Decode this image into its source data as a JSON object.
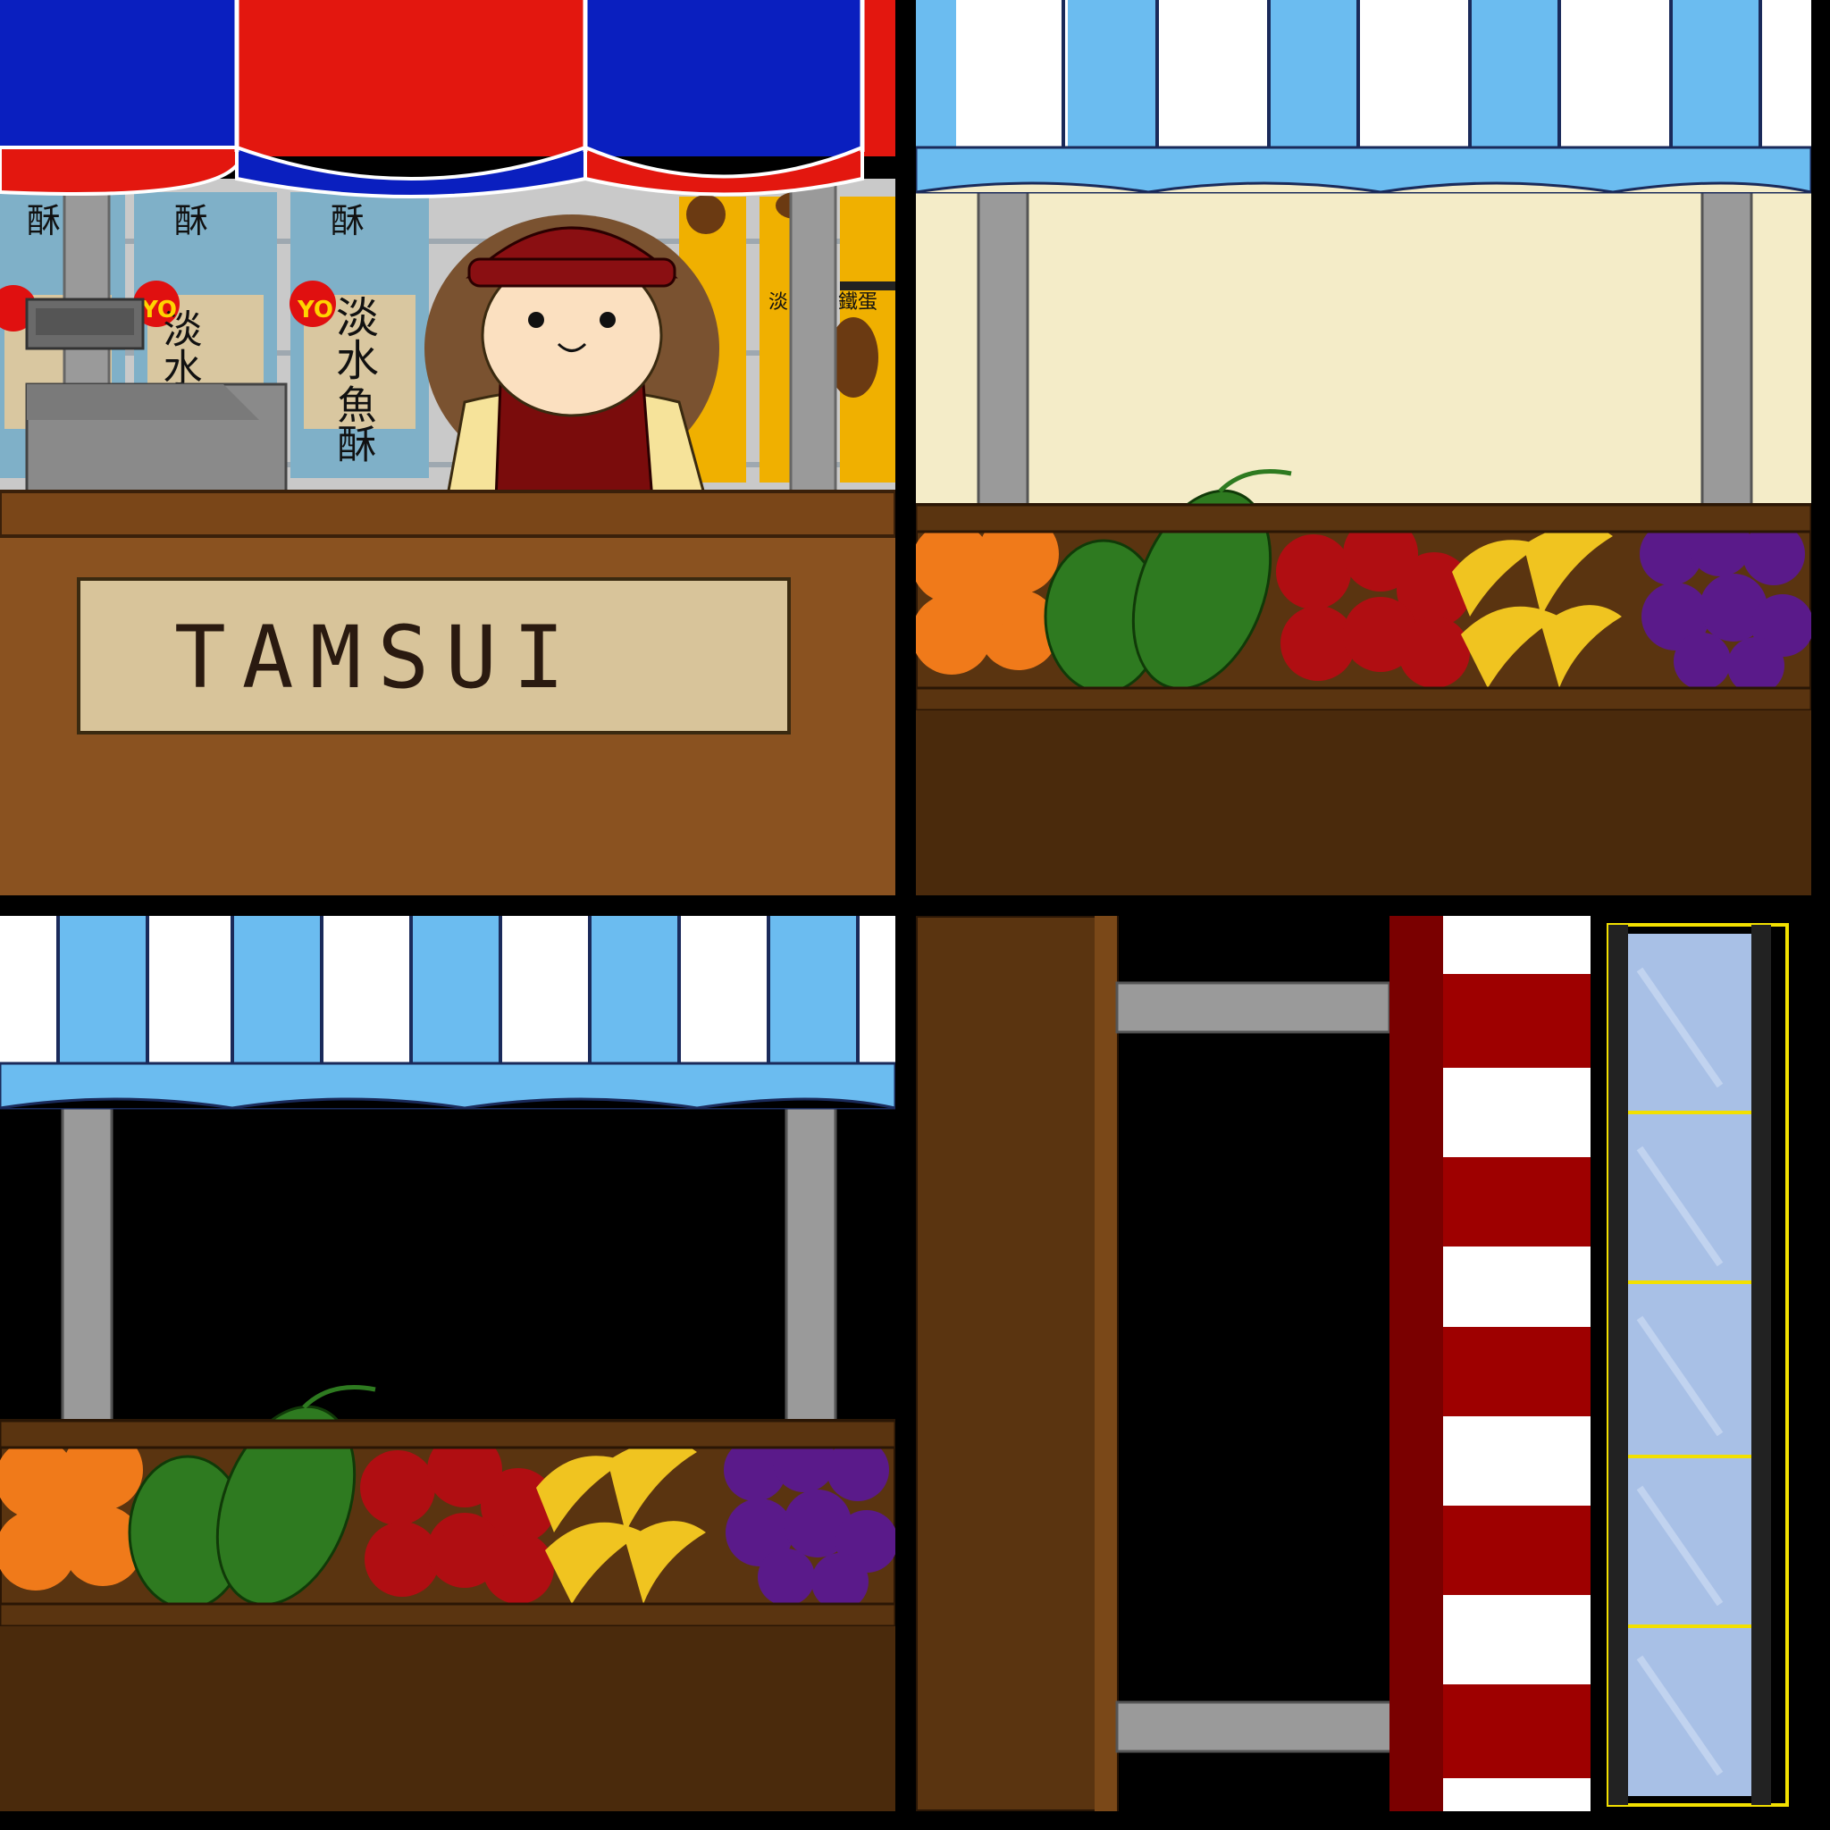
{
  "scene": "tamsui-market-stall-sprite-sheet",
  "colors": {
    "awning_red": "#e3170f",
    "awning_blue": "#0a1fbf",
    "awning_light_blue": "#6bbcf0",
    "cream": "#f4ecc8",
    "wood": "#8a5220",
    "wood_dark": "#5a3410",
    "pole_gray": "#9a9a9a",
    "stripe_red": "#9e0000",
    "glass": "#a8c0e6",
    "frame_yellow": "#f2e000"
  },
  "panels": {
    "shop_counter": {
      "sign_text": "TAMSUI",
      "package_labels": {
        "su": "酥",
        "danshui": "淡水",
        "yu": "魚",
        "yu_su": "魚酥",
        "dan": "淡",
        "tiedan": "鐵蛋",
        "yo": "YO"
      },
      "characters": {
        "shopkeeper": "shopkeeper-girl",
        "register": "cash-register"
      }
    },
    "fruit_stall_wall": {
      "fruits": [
        "oranges",
        "watermelons",
        "apples",
        "bananas",
        "grapes"
      ]
    },
    "fruit_stall_open": {
      "fruits": [
        "oranges",
        "watermelons",
        "apples",
        "bananas",
        "grapes"
      ]
    },
    "side_parts": {
      "items": [
        "wood-pillar",
        "gray-rails",
        "striped-awning-side",
        "glass-door"
      ]
    }
  }
}
